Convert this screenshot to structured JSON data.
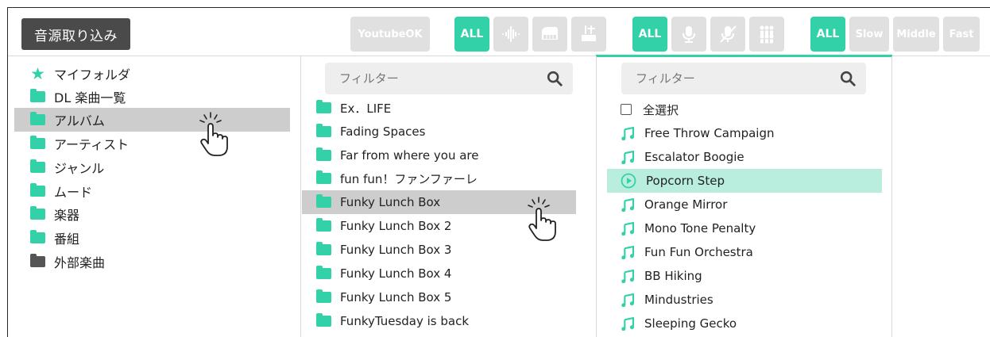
{
  "toolbar": {
    "import_label": "音源取り込み",
    "youtube_label": "YoutubeOK",
    "inst_all_label": "ALL",
    "vocal_all_label": "ALL",
    "tempo_all_label": "ALL",
    "tempo_slow_label": "Slow",
    "tempo_middle_label": "Middle",
    "tempo_fast_label": "Fast",
    "accent_color": "#33d1a8",
    "inactive_color": "#e0e0e0"
  },
  "sidebar": {
    "items": [
      {
        "label": "マイフォルダ",
        "icon": "star-icon"
      },
      {
        "label": "DL 楽曲一覧",
        "icon": "folder-icon"
      },
      {
        "label": "アルバム",
        "icon": "folder-icon"
      },
      {
        "label": "アーティスト",
        "icon": "folder-icon"
      },
      {
        "label": "ジャンル",
        "icon": "folder-icon"
      },
      {
        "label": "ムード",
        "icon": "folder-icon"
      },
      {
        "label": "楽器",
        "icon": "folder-icon"
      },
      {
        "label": "番組",
        "icon": "folder-icon"
      },
      {
        "label": "外部楽曲",
        "icon": "folder-icon"
      }
    ],
    "selected": "アルバム"
  },
  "albums": {
    "filter_placeholder": "フィルター",
    "items": [
      "Ex．LIFE",
      "Fading Spaces",
      "Far from where you are",
      "fun fun！ファンファーレ",
      "Funky Lunch Box",
      "Funky Lunch Box 2",
      "Funky Lunch Box 3",
      "Funky Lunch Box 4",
      "Funky Lunch Box 5",
      "FunkyTuesday is back"
    ],
    "selected": "Funky Lunch Box"
  },
  "tracks": {
    "filter_placeholder": "フィルター",
    "select_all_label": "全選択",
    "items": [
      "Free Throw Campaign",
      "Escalator Boogie",
      "Popcorn Step",
      "Orange Mirror",
      "Mono Tone Penalty",
      "Fun Fun Orchestra",
      "BB Hiking",
      "Mindustries",
      "Sleeping Gecko"
    ],
    "playing": "Popcorn Step"
  }
}
